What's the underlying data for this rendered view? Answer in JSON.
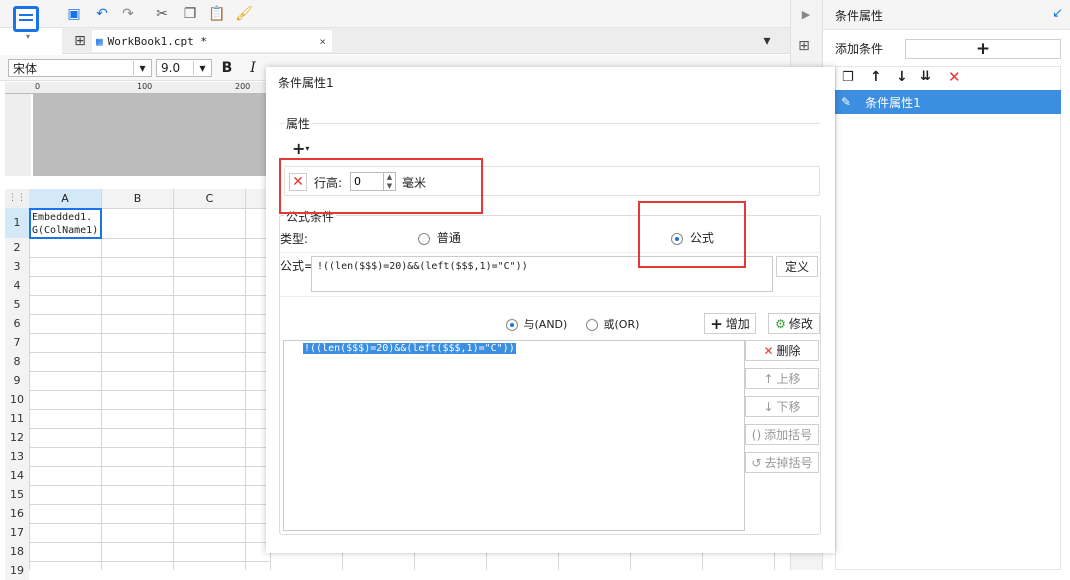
{
  "tab": {
    "title": "WorkBook1.cpt *"
  },
  "font": {
    "name": "宋体",
    "size": "9.0"
  },
  "ruler": {
    "marks": [
      "0",
      "100",
      "200"
    ]
  },
  "columns": [
    "A",
    "B",
    "C"
  ],
  "rows": [
    "1",
    "2",
    "3",
    "4",
    "5",
    "6",
    "7",
    "8",
    "9",
    "10",
    "11",
    "12",
    "13",
    "14",
    "15",
    "16",
    "17",
    "18",
    "19"
  ],
  "cell_a1": {
    "line1": "Embedded1.",
    "line2": "G(ColName1)"
  },
  "dialog": {
    "title": "条件属性1",
    "attr_section": "属性",
    "row_height_label": "行高:",
    "row_height_value": "0",
    "row_height_unit": "毫米",
    "formula_section": "公式条件",
    "type_label": "类型:",
    "type_normal": "普通",
    "type_formula": "公式",
    "formula_label": "公式=",
    "formula_value": "!((len($$$)=20)&&(left($$$,1)=\"C\"))",
    "define_button": "定义",
    "and_label": "与(AND)",
    "or_label": "或(OR)",
    "add_button": "增加",
    "modify_button": "修改",
    "list_item": "!((len($$$)=20)&&(left($$$,1)=\"C\"))",
    "delete_button": "删除",
    "up_button": "上移",
    "down_button": "下移",
    "add_bracket_button": "添加括号",
    "remove_bracket_button": "去掉括号"
  },
  "panel": {
    "title": "条件属性",
    "add_condition_label": "添加条件",
    "add_symbol": "+",
    "list_item": "条件属性1"
  },
  "colors": {
    "accent": "#1a73e8",
    "selected": "#3b8ee0",
    "red": "#e53935"
  }
}
